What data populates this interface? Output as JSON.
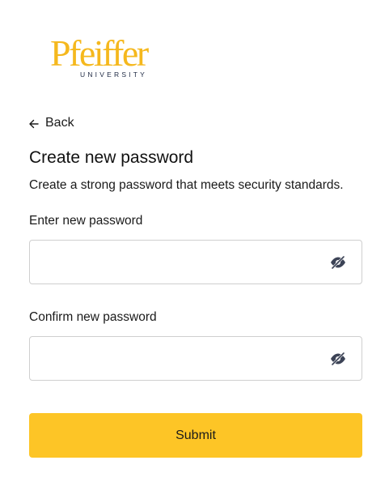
{
  "logo": {
    "word": "Pfeiffer",
    "sub": "UNIVERSITY"
  },
  "back": {
    "label": "Back"
  },
  "page": {
    "title": "Create new password",
    "subtitle": "Create a strong password that meets security standards."
  },
  "fields": {
    "new_password": {
      "label": "Enter new password",
      "value": "",
      "icon": "eye-slash-icon"
    },
    "confirm_password": {
      "label": "Confirm new password",
      "value": "",
      "icon": "eye-slash-icon"
    }
  },
  "submit": {
    "label": "Submit"
  },
  "colors": {
    "brand_gold": "#fdc526",
    "logo_gold": "#f5b81d",
    "logo_navy": "#1f2a44",
    "icon": "#3c4356"
  }
}
